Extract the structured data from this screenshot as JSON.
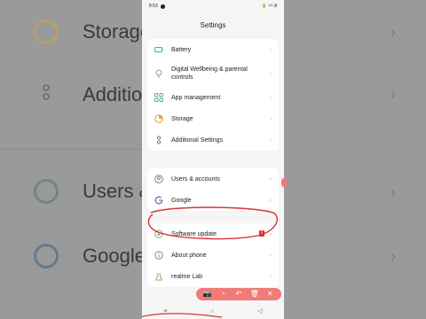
{
  "status_bar": {
    "time": "8:53",
    "right_icons": "🔋 ⁴ᴳ ıll"
  },
  "page_title": "Settings",
  "groups": [
    {
      "items": [
        {
          "label": "Battery",
          "icon": "battery-icon",
          "color": "#3ac26a"
        },
        {
          "label": "Digital Wellbeing & parental controls",
          "icon": "wellbeing-icon",
          "color": "#9a9a9a"
        },
        {
          "label": "App management",
          "icon": "app-grid-icon",
          "color": "#46b97a"
        },
        {
          "label": "Storage",
          "icon": "storage-pie-icon",
          "color": "#f0a23a"
        },
        {
          "label": "Additional Settings",
          "icon": "dots-icon",
          "color": "#777777"
        }
      ]
    },
    {
      "items": [
        {
          "label": "Users & accounts",
          "icon": "user-icon",
          "color": "#6b8aa3"
        },
        {
          "label": "Google",
          "icon": "google-icon",
          "color": "#5a7fb0"
        }
      ]
    },
    {
      "items": [
        {
          "label": "Software update",
          "icon": "software-update-icon",
          "color": "#7ab08a",
          "badge": "1"
        },
        {
          "label": "About phone",
          "icon": "info-icon",
          "color": "#8a8a8a"
        },
        {
          "label": "realme Lab",
          "icon": "lab-flask-icon",
          "color": "#b9a06a"
        }
      ]
    }
  ],
  "chevron": "›",
  "background": {
    "rows": [
      {
        "text": "Storage"
      },
      {
        "text": "Additio"
      },
      {
        "text": "Users &"
      },
      {
        "text": "Google"
      }
    ]
  },
  "toolbar": {
    "buttons": [
      "📷",
      "◔",
      "↶",
      "🗑",
      "✕"
    ]
  },
  "nav": {
    "menu": "≡",
    "home": "○",
    "back": "◁"
  },
  "accent_color": "#e0303a"
}
